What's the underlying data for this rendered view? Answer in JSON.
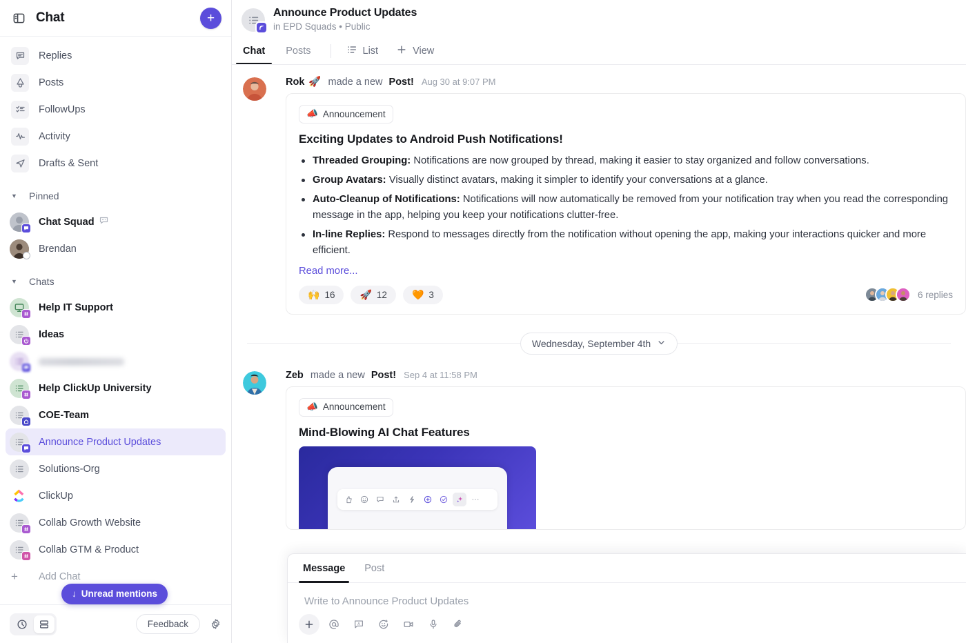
{
  "sidebar": {
    "header": {
      "title": "Chat",
      "panel_icon": "panel-toggle-icon",
      "new_label": "+"
    },
    "nav": [
      {
        "label": "Replies",
        "icon": "replies-icon"
      },
      {
        "label": "Posts",
        "icon": "megaphone-icon"
      },
      {
        "label": "FollowUps",
        "icon": "checklist-icon"
      },
      {
        "label": "Activity",
        "icon": "activity-pulse-icon"
      },
      {
        "label": "Drafts & Sent",
        "icon": "send-icon"
      }
    ],
    "sections": [
      {
        "label": "Pinned",
        "items": [
          {
            "label": "Chat Squad",
            "bold": true,
            "avatar": "group-avatar",
            "badge": "chat-badge",
            "trailing_icon": "speech-bubble-icon"
          },
          {
            "label": "Brendan",
            "bold": false,
            "avatar": "person-avatar",
            "badge": "offline-status"
          }
        ]
      },
      {
        "label": "Chats",
        "items": [
          {
            "label": "Help IT Support",
            "bold": true,
            "avatar": "monitor-avatar",
            "badge": "hash-badge"
          },
          {
            "label": "Ideas",
            "bold": true,
            "avatar": "list-avatar",
            "badge": "power-badge"
          },
          {
            "label": "",
            "bold": false,
            "avatar": "list-avatar",
            "badge": "chat-badge",
            "redacted": true
          },
          {
            "label": "Help ClickUp University",
            "bold": true,
            "avatar": "list-avatar",
            "badge": "hash-badge"
          },
          {
            "label": "COE-Team",
            "bold": true,
            "avatar": "list-avatar",
            "badge": "home-badge"
          },
          {
            "label": "Announce Product Updates",
            "bold": false,
            "avatar": "list-avatar",
            "badge": "chat-badge",
            "active": true
          },
          {
            "label": "Solutions-Org",
            "bold": false,
            "avatar": "list-avatar",
            "badge": "none"
          },
          {
            "label": "ClickUp",
            "bold": false,
            "avatar": "clickup-logo",
            "badge": "none"
          },
          {
            "label": "Collab Growth Website",
            "bold": false,
            "avatar": "list-avatar",
            "badge": "hash-badge"
          },
          {
            "label": "Collab GTM & Product",
            "bold": false,
            "avatar": "list-avatar",
            "badge": "hash-badge"
          }
        ]
      }
    ],
    "add_chat_label": "Add Chat",
    "unread_pill": {
      "label": "Unread mentions",
      "arrow": "↓"
    },
    "footer": {
      "history_icon": "clock-icon",
      "layout_icon": "rows-layout-icon",
      "feedback_label": "Feedback",
      "settings_icon": "gear-icon"
    }
  },
  "header": {
    "title": "Announce Product Updates",
    "subtitle": "in EPD Squads • Public",
    "avatar_icon": "channel-list-avatar",
    "tabs": [
      {
        "label": "Chat",
        "active": true
      },
      {
        "label": "Posts",
        "active": false
      }
    ],
    "list_view": {
      "label": "List",
      "icon": "list-icon"
    },
    "add_view": {
      "label": "View",
      "icon": "plus-icon"
    }
  },
  "feed": {
    "posts": [
      {
        "author": "Rok",
        "author_emoji": "🚀",
        "action_prefix": "made a new",
        "action_strong": "Post!",
        "timestamp": "Aug 30 at 9:07 PM",
        "badge": {
          "label": "Announcement",
          "emoji": "📣"
        },
        "title": "Exciting Updates to Android Push Notifications!",
        "bullets": [
          {
            "lead": "Threaded Grouping:",
            "text": " Notifications are now grouped by thread, making it easier to stay organized and follow conversations."
          },
          {
            "lead": "Group Avatars:",
            "text": " Visually distinct avatars, making it simpler to identify your conversations at a glance."
          },
          {
            "lead": "Auto-Cleanup of Notifications:",
            "text": " Notifications will now automatically be removed from your notification tray when you read the corresponding message in the app, helping you keep your notifications clutter-free."
          },
          {
            "lead": "In-line Replies:",
            "text": " Respond to messages directly from the notification without opening the app, making your interactions quicker and more efficient."
          }
        ],
        "read_more": "Read more...",
        "reactions": [
          {
            "emoji": "🙌",
            "count": "16"
          },
          {
            "emoji": "🚀",
            "count": "12"
          },
          {
            "emoji": "🧡",
            "count": "3"
          }
        ],
        "replies_label": "6 replies",
        "replies_avatar_count": 4
      },
      {
        "author": "Zeb",
        "author_emoji": "",
        "action_prefix": "made a new",
        "action_strong": "Post!",
        "timestamp": "Sep 4 at 11:58 PM",
        "badge": {
          "label": "Announcement",
          "emoji": "📣"
        },
        "title": "Mind-Blowing AI Chat Features",
        "image_toolbar_icons": [
          "thumbs-up-icon",
          "emoji-icon",
          "comment-icon",
          "share-icon",
          "lightning-icon",
          "add-circle-icon",
          "check-circle-icon",
          "ai-sparkle-icon",
          "more-icon"
        ]
      }
    ],
    "date_divider": {
      "label": "Wednesday, September 4th",
      "chevron": "chevron-down-icon"
    }
  },
  "composer": {
    "tabs": [
      {
        "label": "Message",
        "active": true
      },
      {
        "label": "Post",
        "active": false
      }
    ],
    "placeholder": "Write to Announce Product Updates",
    "tools": [
      {
        "icon": "plus-icon",
        "active": true
      },
      {
        "icon": "mention-icon",
        "active": false
      },
      {
        "icon": "ai-assist-icon",
        "active": false
      },
      {
        "icon": "emoji-icon",
        "active": false
      },
      {
        "icon": "video-icon",
        "active": false
      },
      {
        "icon": "microphone-icon",
        "active": false
      },
      {
        "icon": "attachment-icon",
        "active": false
      }
    ]
  },
  "colors": {
    "accent": "#5b4ddb",
    "active_bg": "#eceafb",
    "text": "#16181d",
    "muted": "#8b909c",
    "border": "#e8e8ec"
  }
}
